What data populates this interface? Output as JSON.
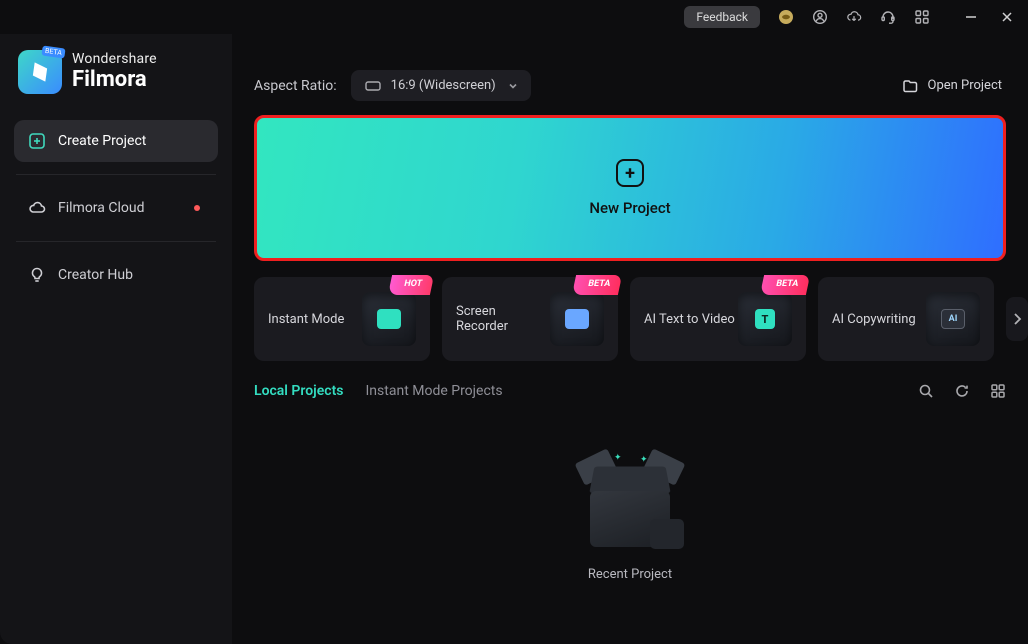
{
  "titlebar": {
    "feedback": "Feedback"
  },
  "brand": {
    "line1": "Wondershare",
    "line2": "Filmora",
    "beta": "BETA"
  },
  "sidebar": {
    "items": [
      {
        "label": "Create Project"
      },
      {
        "label": "Filmora Cloud"
      },
      {
        "label": "Creator Hub"
      }
    ]
  },
  "toolbar": {
    "aspect_ratio_label": "Aspect Ratio:",
    "aspect_ratio_value": "16:9 (Widescreen)",
    "open_project": "Open Project"
  },
  "new_project": {
    "label": "New Project"
  },
  "features": [
    {
      "label": "Instant Mode",
      "badge": "HOT"
    },
    {
      "label": "Screen Recorder",
      "badge": "BETA"
    },
    {
      "label": "AI Text to Video",
      "badge": "BETA"
    },
    {
      "label": "AI Copywriting",
      "badge": ""
    }
  ],
  "tabs": {
    "local": "Local Projects",
    "instant": "Instant Mode Projects"
  },
  "recent": {
    "label": "Recent Project"
  }
}
